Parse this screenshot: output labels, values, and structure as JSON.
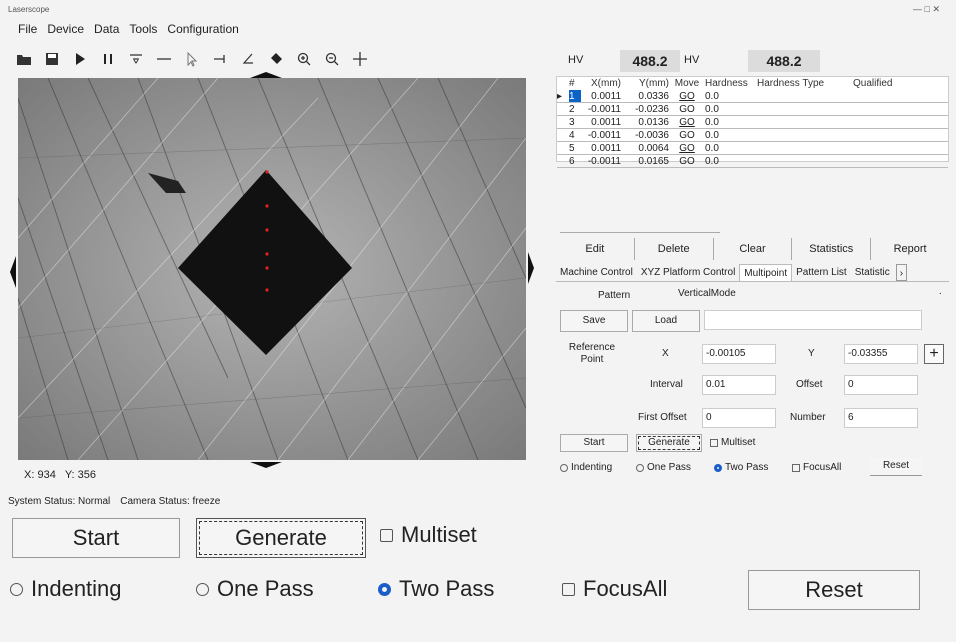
{
  "window": {
    "title": "Laserscope",
    "controls": "— □ ✕"
  },
  "menu": [
    "File",
    "Device",
    "Data",
    "Tools",
    "Configuration"
  ],
  "toolbar_icons": [
    "open-folder-icon",
    "save-icon",
    "play-icon",
    "pause-icon",
    "filter-icon",
    "line-icon",
    "cursor-icon",
    "measure-icon",
    "angle-icon",
    "eraser-icon",
    "zoom-in-icon",
    "zoom-out-icon",
    "crosshair-icon"
  ],
  "hv": {
    "label1": "HV",
    "value1": "488.2",
    "label2": "HV",
    "value2": "488.2"
  },
  "table": {
    "headers": [
      "#",
      "X(mm)",
      "Y(mm)",
      "Move",
      "Hardness",
      "Hardness Type",
      "Qualified"
    ],
    "rows": [
      {
        "n": "1",
        "x": "0.0011",
        "y": "0.0336",
        "move": "GO",
        "hardness": "0.0"
      },
      {
        "n": "2",
        "x": "-0.0011",
        "y": "-0.0236",
        "move": "GO",
        "hardness": "0.0"
      },
      {
        "n": "3",
        "x": "0.0011",
        "y": "0.0136",
        "move": "GO",
        "hardness": "0.0"
      },
      {
        "n": "4",
        "x": "-0.0011",
        "y": "-0.0036",
        "move": "GO",
        "hardness": "0.0"
      },
      {
        "n": "5",
        "x": "0.0011",
        "y": "0.0064",
        "move": "GO",
        "hardness": "0.0"
      },
      {
        "n": "6",
        "x": "-0.0011",
        "y": "0.0165",
        "move": "GO",
        "hardness": "0.0"
      }
    ]
  },
  "actions": [
    "Edit",
    "Delete",
    "Clear",
    "Statistics",
    "Report"
  ],
  "tabs": [
    "Machine Control",
    "XYZ Platform Control",
    "Multipoint",
    "Pattern List",
    "Statistic"
  ],
  "multipoint": {
    "pattern_label": "Pattern",
    "pattern_value": "VerticalMode",
    "save": "Save",
    "load": "Load",
    "ref_label": "Reference Point",
    "x_label": "X",
    "x_value": "-0.00105",
    "y_label": "Y",
    "y_value": "-0.03355",
    "interval_label": "Interval",
    "interval_value": "0.01",
    "offset_label": "Offset",
    "offset_value": "0",
    "first_offset_label": "First Offset",
    "first_offset_value": "0",
    "number_label": "Number",
    "number_value": "6",
    "start": "Start",
    "generate": "Generate",
    "multiset": "Multiset",
    "indenting": "Indenting",
    "one_pass": "One Pass",
    "two_pass": "Two Pass",
    "focusall": "FocusAll",
    "reset": "Reset"
  },
  "coords": {
    "x_label": "X:",
    "x": "934",
    "y_label": "Y:",
    "y": "356"
  },
  "status": {
    "system": "System Status: Normal",
    "camera": "Camera Status: freeze"
  },
  "zoomed": {
    "start": "Start",
    "generate": "Generate",
    "multiset": "Multiset",
    "indenting": "Indenting",
    "one_pass": "One Pass",
    "two_pass": "Two Pass",
    "focusall": "FocusAll",
    "reset": "Reset"
  }
}
